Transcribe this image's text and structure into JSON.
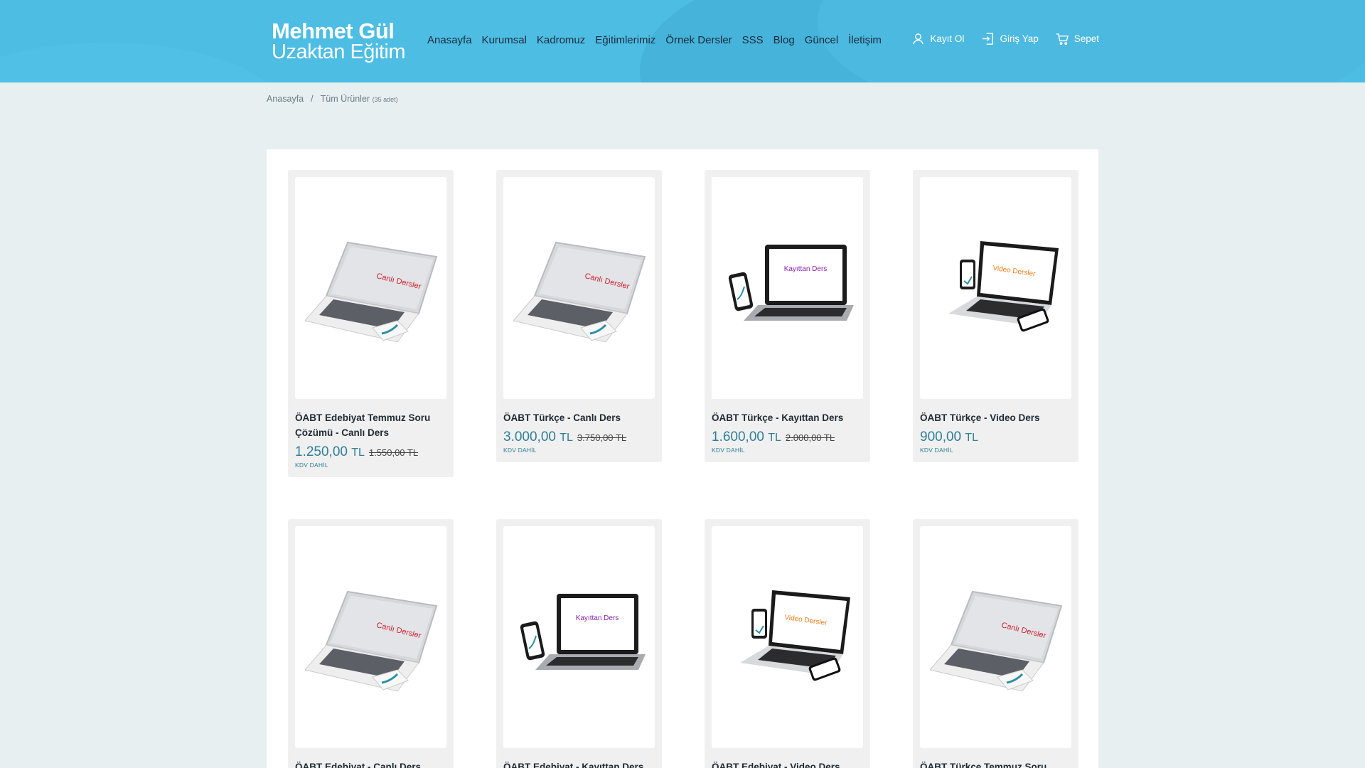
{
  "site": {
    "logo_line1": "Mehmet Gül",
    "logo_line2": "Uzaktan Eğitim",
    "nav": [
      {
        "label": "Anasayfa"
      },
      {
        "label": "Kurumsal"
      },
      {
        "label": "Kadromuz"
      },
      {
        "label": "Eğitimlerimiz"
      },
      {
        "label": "Örnek Dersler"
      },
      {
        "label": "SSS"
      },
      {
        "label": "Blog"
      },
      {
        "label": "Güncel"
      },
      {
        "label": "İletişim"
      }
    ],
    "user_links": {
      "register": "Kayıt Ol",
      "login": "Giriş Yap",
      "cart": "Sepet"
    },
    "icons": {
      "register": "user-icon",
      "login": "login-icon",
      "cart": "cart-icon"
    },
    "colors": {
      "header_bg": "#4dbde4",
      "price": "#2f7f96"
    }
  },
  "breadcrumb": {
    "home": "Anasayfa",
    "separator": "/",
    "current": "Tüm Ürünler",
    "count": "(35 adet)"
  },
  "products": [
    {
      "title": "ÖABT Edebiyat Temmuz Soru Çözümü - Canlı Ders",
      "price": "1.250,00",
      "currency": "TL",
      "old_price": "1.550,00 TL",
      "vat": "KDV DAHİL",
      "image_text": "Canlı Dersler"
    },
    {
      "title": "ÖABT Türkçe - Canlı Ders",
      "price": "3.000,00",
      "currency": "TL",
      "old_price": "3.750,00 TL",
      "vat": "KDV DAHİL",
      "image_text": "Canlı Dersler"
    },
    {
      "title": "ÖABT Türkçe - Kayıttan Ders",
      "price": "1.600,00",
      "currency": "TL",
      "old_price": "2.000,00 TL",
      "vat": "KDV DAHİL",
      "image_text": "Kayıttan Ders"
    },
    {
      "title": "ÖABT Türkçe - Video Ders",
      "price": "900,00",
      "currency": "TL",
      "old_price": "",
      "vat": "KDV DAHİL",
      "image_text": "Video Dersler"
    },
    {
      "title": "ÖABT Edebiyat - Canlı Ders",
      "image_text": "Canlı Dersler"
    },
    {
      "title": "ÖABT Edebiyat - Kayıttan Ders",
      "image_text": "Kayıttan Ders"
    },
    {
      "title": "ÖABT Edebiyat - Video Ders",
      "image_text": "Video Dersler"
    },
    {
      "title": "ÖABT Türkçe Temmuz Soru",
      "image_text": "Canlı Dersler"
    }
  ]
}
